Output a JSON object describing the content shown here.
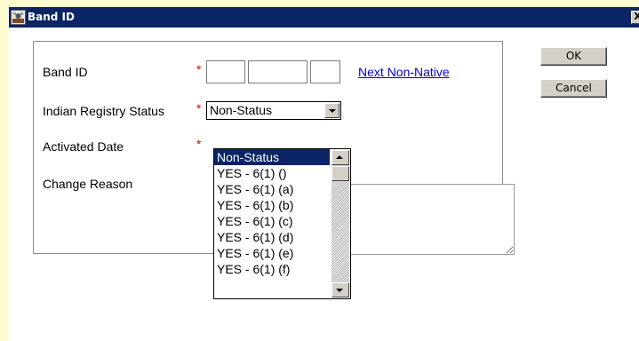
{
  "window": {
    "title": "Band ID",
    "close_label": "X"
  },
  "form": {
    "band_id_label": "Band ID",
    "band_id_values": [
      "",
      "",
      ""
    ],
    "next_non_native_link": "Next Non-Native",
    "registry_status_label": "Indian Registry Status",
    "registry_status_value": "Non-Status",
    "activated_date_label": "Activated Date",
    "change_reason_label": "Change Reason",
    "change_reason_value": "",
    "required_marker": "*"
  },
  "dropdown": {
    "options": [
      "Non-Status",
      "YES - 6(1) ()",
      "YES - 6(1) (a)",
      "YES - 6(1) (b)",
      "YES - 6(1) (c)",
      "YES - 6(1) (d)",
      "YES - 6(1) (e)",
      "YES - 6(1) (f)"
    ],
    "selected": "Non-Status"
  },
  "buttons": {
    "ok_label": "OK",
    "cancel_label": "Cancel"
  },
  "colors": {
    "titlebar": "#0a2465",
    "background": "#fffdd0",
    "required": "#e00000",
    "link": "#0000e0",
    "selection": "#0a2465"
  }
}
